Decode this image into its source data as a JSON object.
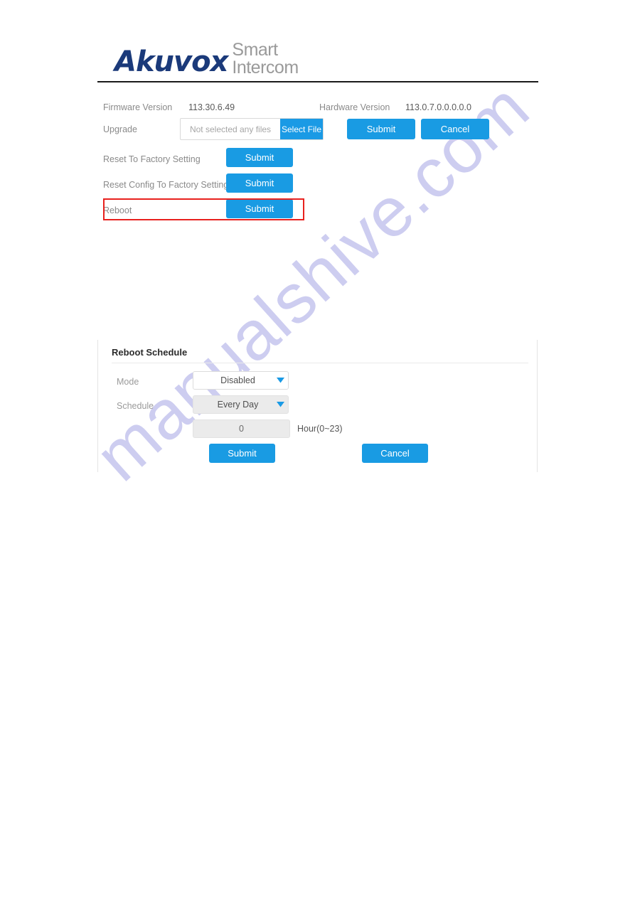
{
  "watermark": {
    "text": "manualshive.com",
    "color": "#c9c9ef"
  },
  "brand": {
    "name": "Akuvox",
    "tagline_line1": "Smart",
    "tagline_line2": "Intercom",
    "name_color": "#1b3a7a",
    "tagline_color": "#9a9a9a"
  },
  "upgrade": {
    "firmware_label": "Firmware Version",
    "firmware_value": "113.30.6.49",
    "hardware_label": "Hardware Version",
    "hardware_value": "113.0.7.0.0.0.0.0",
    "upgrade_label": "Upgrade",
    "file_placeholder": "Not selected any files",
    "select_file_label": "Select File",
    "submit_label": "Submit",
    "cancel_label": "Cancel",
    "reset_factory_label": "Reset To Factory Setting",
    "reset_factory_submit": "Submit",
    "reset_config_label": "Reset Config To Factory Setting",
    "reset_config_submit": "Submit",
    "reboot_label": "Reboot",
    "reboot_submit": "Submit",
    "highlight_color": "#e8211e",
    "accent_color": "#199be3"
  },
  "schedule": {
    "title": "Reboot Schedule",
    "mode_label": "Mode",
    "mode_value": "Disabled",
    "schedule_label": "Schedule",
    "schedule_value": "Every Day",
    "hour_value": "0",
    "hour_hint": "Hour(0~23)",
    "submit_label": "Submit",
    "cancel_label": "Cancel"
  }
}
